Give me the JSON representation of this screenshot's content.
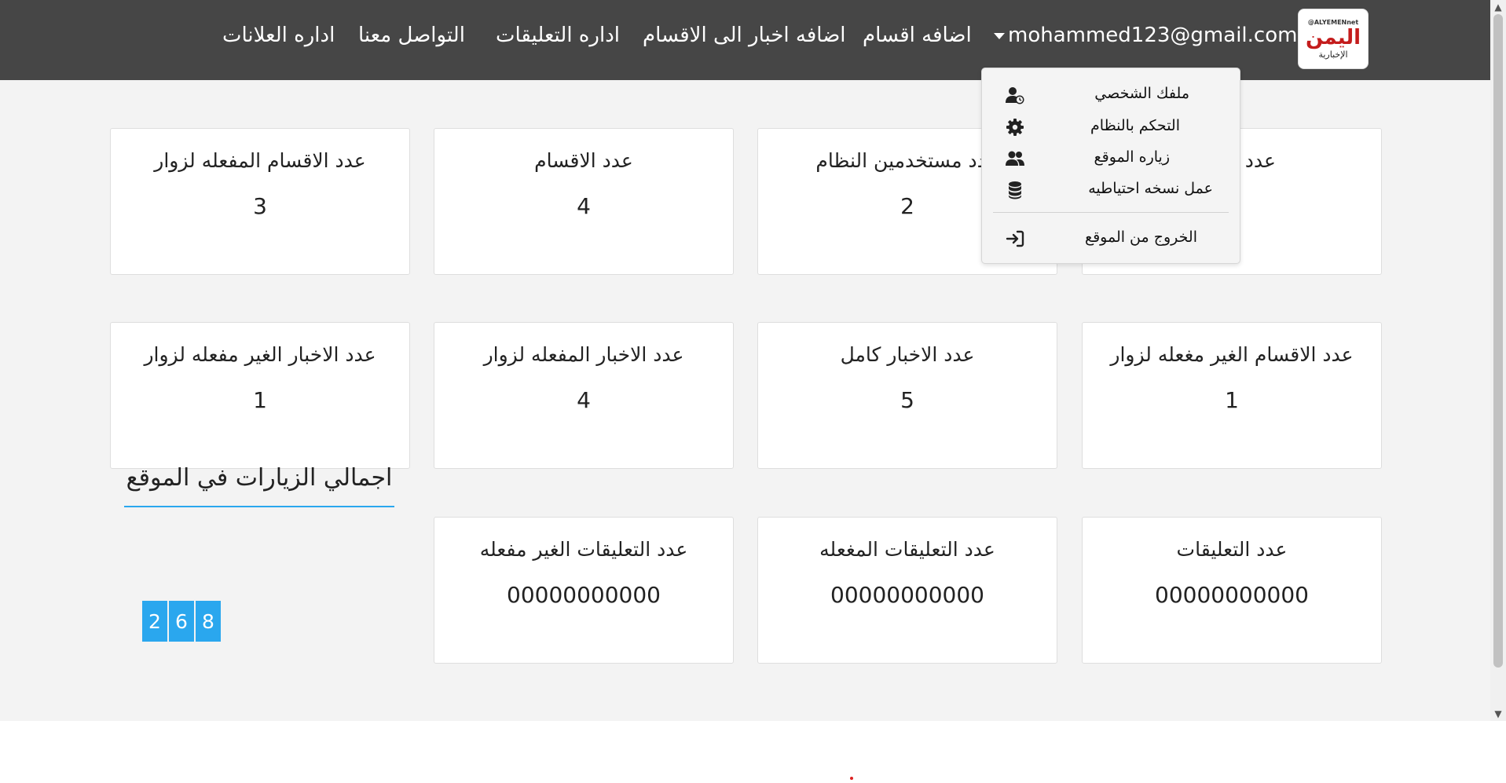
{
  "nav": {
    "logo": {
      "tag": "@ALYEMENnet",
      "name": "اليمن",
      "sub": "الإخبارية"
    },
    "user_email": "mohammed123@gmail.com",
    "items": [
      "اضافه اقسام",
      "اضافه اخبار الى الاقسام",
      "اداره التعليقات",
      "التواصل معنا",
      "اداره العلانات"
    ]
  },
  "dropdown": {
    "items": [
      {
        "label": "ملفك الشخصي",
        "icon": "user-clock-icon"
      },
      {
        "label": "التحكم بالنظام",
        "icon": "gear-icon"
      },
      {
        "label": "زياره الموقع",
        "icon": "users-icon"
      },
      {
        "label": "عمل نسخه احتياطيه",
        "icon": "database-icon"
      }
    ],
    "logout": {
      "label": "الخروج من الموقع",
      "icon": "sign-in-icon"
    }
  },
  "cards": [
    {
      "title": "عدد الادمن",
      "value": ""
    },
    {
      "title": "عدد مستخدمين النظام",
      "value": "2"
    },
    {
      "title": "عدد الاقسام",
      "value": "4"
    },
    {
      "title": "عدد الاقسام المفعله لزوار",
      "value": "3"
    },
    {
      "title": "عدد الاقسام الغير مغعله لزوار",
      "value": "1"
    },
    {
      "title": "عدد الاخبار كامل",
      "value": "5"
    },
    {
      "title": "عدد الاخبار المفعله لزوار",
      "value": "4"
    },
    {
      "title": "عدد الاخبار الغير مفعله لزوار",
      "value": "1"
    },
    {
      "title": "عدد التعليقات",
      "value": "00000000000"
    },
    {
      "title": "عدد التعليقات المغعله",
      "value": "00000000000"
    },
    {
      "title": "عدد التعليقات الغير مفعله",
      "value": "00000000000"
    }
  ],
  "visits": {
    "title": "اجمالي الزيارات في الموقع",
    "digits": [
      "2",
      "6",
      "8"
    ]
  },
  "colors": {
    "navbar": "#464646",
    "background": "#f3f3f3",
    "accent": "#2aa7ee",
    "logo_red": "#c41c1c"
  }
}
